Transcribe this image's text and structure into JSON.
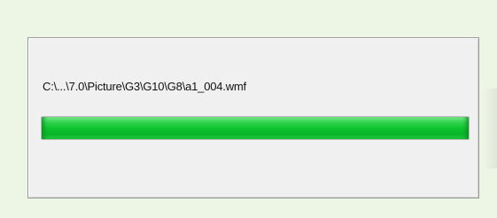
{
  "dialog": {
    "file_path": "C:\\...\\7.0\\Picture\\G3\\G10\\G8\\a1_004.wmf",
    "progress_percent": 100,
    "progress_color": "#12c232",
    "background_color": "#edf5e4"
  }
}
